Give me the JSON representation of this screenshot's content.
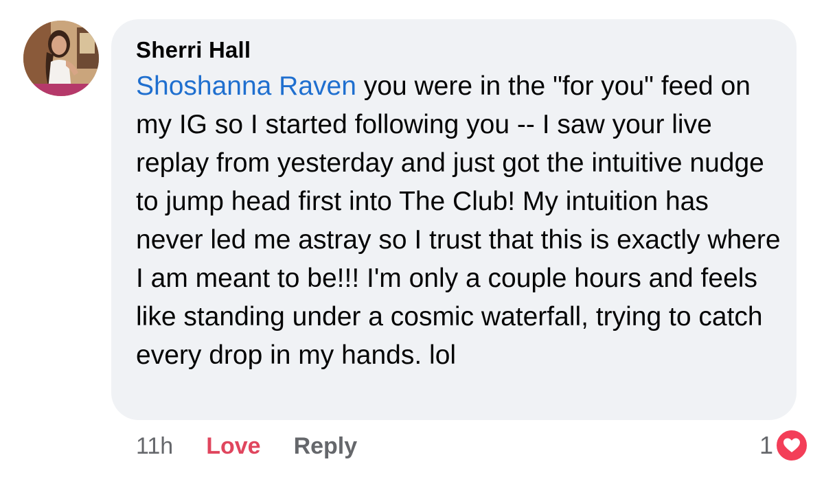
{
  "comment": {
    "author": "Sherri Hall",
    "mention": "Shoshanna Raven",
    "text": " you were in the \"for you\" feed on my IG so I started following you -- I saw your live replay from yesterday and just got the intuitive nudge to jump head first into The Club! My intuition has never led me astray so I trust that this is exactly where I am meant to be!!! I'm only a couple hours and feels like standing under a cosmic waterfall, trying to catch every drop in my hands. lol",
    "avatar_icon": "profile-photo"
  },
  "actions": {
    "time": "11h",
    "love_label": "Love",
    "reply_label": "Reply"
  },
  "reactions": {
    "count": "1",
    "icon": "heart-icon",
    "color": "#f33e58"
  },
  "colors": {
    "bubble": "#f0f2f5",
    "mention": "#1f6fcf",
    "love": "#e0465e",
    "muted": "#65676b"
  }
}
